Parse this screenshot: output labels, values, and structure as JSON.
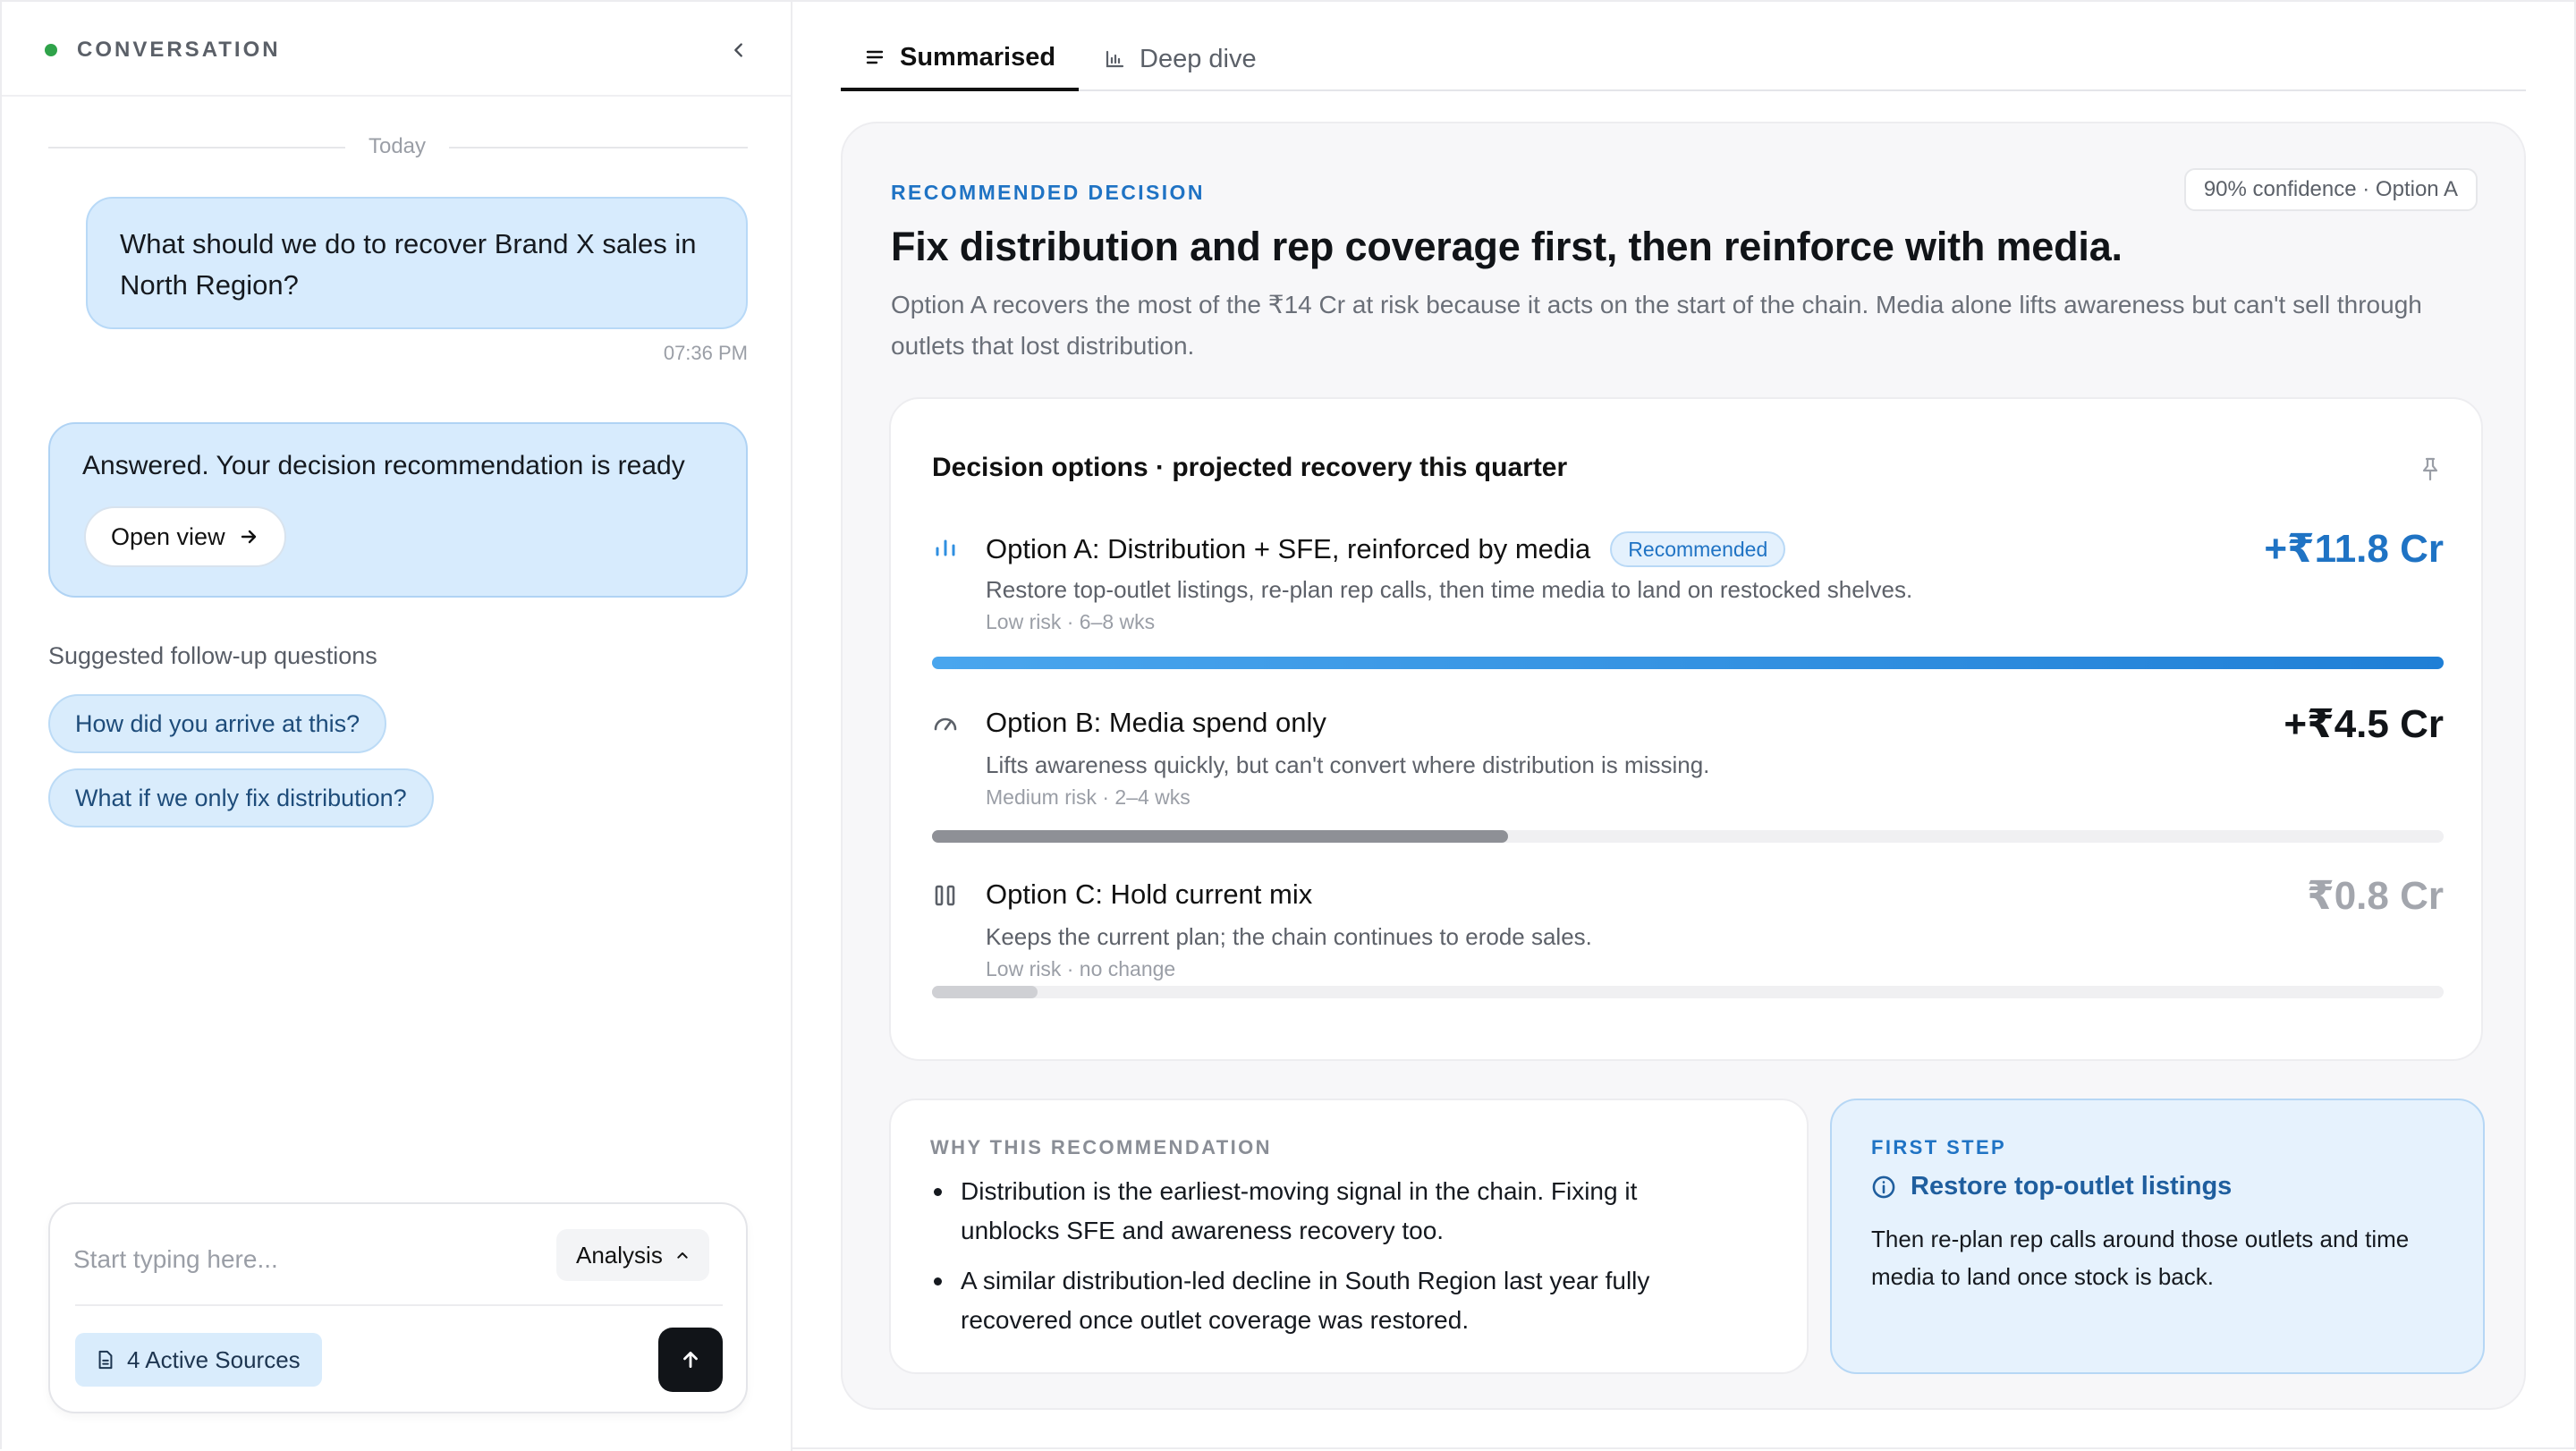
{
  "conversation": {
    "title": "CONVERSATION",
    "date_divider": "Today",
    "user_message": "What should we do to recover Brand X sales in North Region?",
    "user_message_time": "07:36 PM",
    "answer": {
      "text": "Answered. Your decision recommendation is ready",
      "open_view_label": "Open view"
    },
    "suggested_label": "Suggested follow-up questions",
    "suggestions": [
      "How did you arrive at this?",
      "What if we only fix distribution?"
    ],
    "composer": {
      "placeholder": "Start typing here...",
      "mode": "Analysis",
      "sources_label": "4 Active Sources"
    }
  },
  "tabs": [
    {
      "label": "Summarised",
      "icon": "list-icon",
      "active": true
    },
    {
      "label": "Deep dive",
      "icon": "bar-chart-icon",
      "active": false
    }
  ],
  "recommendation": {
    "label": "RECOMMENDED DECISION",
    "confidence": "90% confidence · Option A",
    "headline": "Fix distribution and rep coverage first, then reinforce with media.",
    "subtext": "Option A recovers the most of the ₹14 Cr at risk because it acts on the start of the chain. Media alone lifts awareness but can't sell through outlets that lost distribution."
  },
  "options_card": {
    "title": "Decision options · projected recovery this quarter",
    "options": [
      {
        "title": "Option A: Distribution + SFE, reinforced by media",
        "badge": "Recommended",
        "description": "Restore top-outlet listings, re-plan rep calls, then time media to land on restocked shelves.",
        "meta": "Low risk · 6–8 wks",
        "value": "+₹11.8 Cr",
        "icon": "bar-chart-icon",
        "recovery_cr": 11.8,
        "color": "#1f73c4"
      },
      {
        "title": "Option B: Media spend only",
        "badge": "",
        "description": "Lifts awareness quickly, but can't convert where distribution is missing.",
        "meta": "Medium risk · 2–4 wks",
        "value": "+₹4.5 Cr",
        "icon": "gauge-icon",
        "recovery_cr": 4.5,
        "color": "#111418"
      },
      {
        "title": "Option C: Hold current mix",
        "badge": "",
        "description": "Keeps the current plan; the chain continues to erode sales.",
        "meta": "Low risk · no change",
        "value": "₹0.8 Cr",
        "icon": "pause-icon",
        "recovery_cr": 0.8,
        "color": "#a3a6ad"
      }
    ]
  },
  "why": {
    "title": "WHY THIS RECOMMENDATION",
    "points": [
      "Distribution is the earliest-moving signal in the chain. Fixing it unblocks SFE and awareness recovery too.",
      "A similar distribution-led decline in South Region last year fully recovered once outlet coverage was restored."
    ]
  },
  "first_step": {
    "title": "FIRST STEP",
    "step": "Restore top-outlet listings",
    "description": "Then re-plan rep calls around those outlets and time media to land once stock is back."
  }
}
